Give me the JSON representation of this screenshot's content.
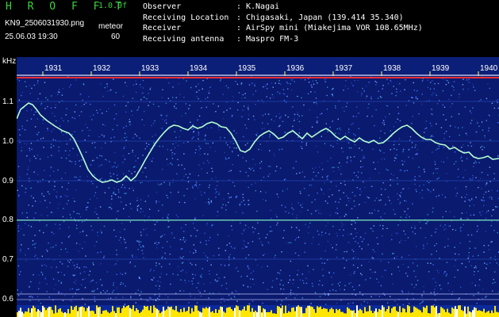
{
  "header": {
    "app_name": "H R O F F T",
    "version": "1.0.0f",
    "filename": "KN9_2506031930.png",
    "datetime": "25.06.03 19:30",
    "meteor_label": "meteor",
    "meteor_value": "60"
  },
  "station_info": [
    {
      "key": "Observer",
      "value": "K.Nagai"
    },
    {
      "key": "Receiving Location",
      "value": "Chigasaki, Japan (139.414 35.340)"
    },
    {
      "key": "Receiver",
      "value": "AirSpy mini (Miakejima VOR 108.65MHz)"
    },
    {
      "key": "Receiving antenna",
      "value": "Maspro FM-3"
    }
  ],
  "axis": {
    "y_unit": "kHz",
    "y_ticks": [
      "1.1",
      "1.0",
      "0.9",
      "0.8",
      "0.7",
      "0.6"
    ],
    "x_ticks": [
      "1931",
      "1932",
      "1933",
      "1934",
      "1935",
      "1936",
      "1937",
      "1938",
      "1939",
      "1940"
    ]
  },
  "colors": {
    "background": "#000000",
    "spectrogram_bg": "#0a1a6e",
    "trace": "#b4ffd2",
    "title_green": "#3cd23c",
    "carrier_red": "#ff3030",
    "amplitude_yellow": "#ffe600"
  }
}
